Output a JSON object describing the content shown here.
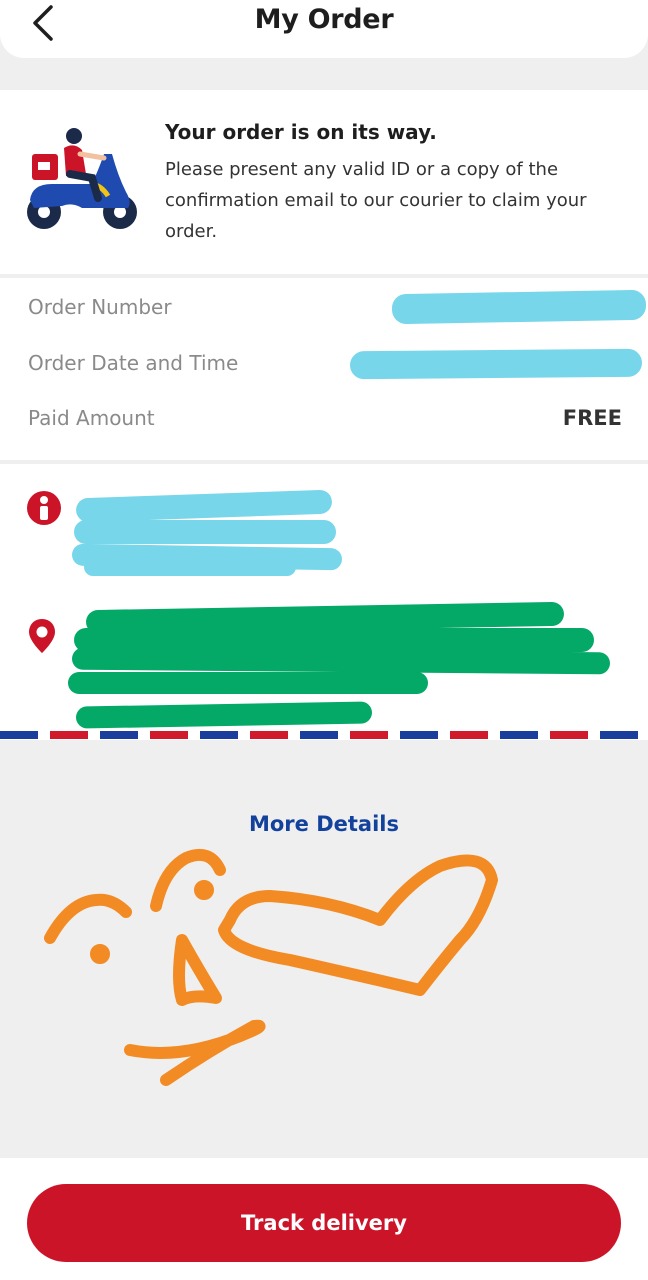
{
  "header": {
    "title": "My Order",
    "back_icon": "chevron-left-icon"
  },
  "status": {
    "illustration": "scooter-courier-illustration",
    "title": "Your order is on its way.",
    "description": "Please present any valid ID or a copy of the confirmation email to our courier to claim your order."
  },
  "order_info": {
    "rows": [
      {
        "label": "Order Number",
        "value": ""
      },
      {
        "label": "Order Date and Time",
        "value": ""
      },
      {
        "label": "Paid Amount",
        "value": "FREE"
      }
    ]
  },
  "address": {
    "person_icon": "person-info-icon",
    "location_icon": "location-pin-icon"
  },
  "more_details_label": "More Details",
  "track_button_label": "Track delivery",
  "colors": {
    "brand_red": "#cc1429",
    "link_blue": "#12429c",
    "redact_cyan": "#77d6ea",
    "redact_green": "#04a867",
    "scribble_orange": "#f38b24"
  }
}
